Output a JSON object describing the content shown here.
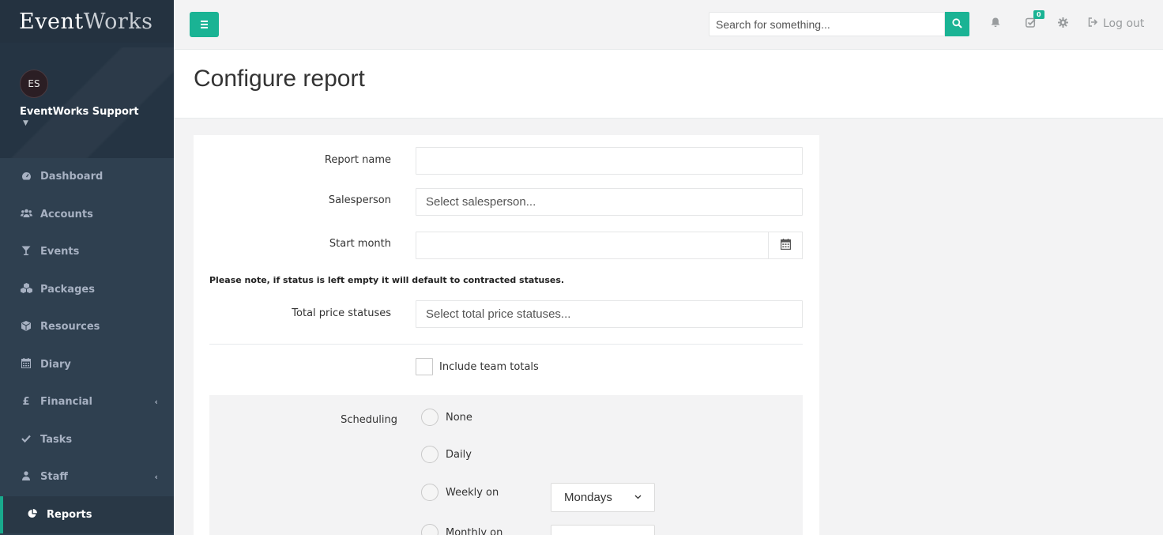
{
  "app": {
    "logo_part1": "Event",
    "logo_part2": "Works"
  },
  "profile": {
    "initials": "ES",
    "name": "EventWorks Support"
  },
  "nav": {
    "items": [
      {
        "label": "Dashboard",
        "icon": "tachometer-icon"
      },
      {
        "label": "Accounts",
        "icon": "users-icon"
      },
      {
        "label": "Events",
        "icon": "glass-icon"
      },
      {
        "label": "Packages",
        "icon": "cubes-icon"
      },
      {
        "label": "Resources",
        "icon": "cube-icon"
      },
      {
        "label": "Diary",
        "icon": "calendar-icon"
      },
      {
        "label": "Financial",
        "icon": "pound-icon"
      },
      {
        "label": "Tasks",
        "icon": "check-icon"
      },
      {
        "label": "Staff",
        "icon": "user-icon"
      },
      {
        "label": "Reports",
        "icon": "pie-chart-icon"
      }
    ],
    "active": "Reports"
  },
  "topbar": {
    "search_placeholder": "Search for something...",
    "tasks_badge": "0",
    "logout_label": "Log out"
  },
  "page": {
    "title": "Configure report"
  },
  "form": {
    "report_name_label": "Report name",
    "report_name_value": "",
    "salesperson_label": "Salesperson",
    "salesperson_placeholder": "Select salesperson...",
    "start_month_label": "Start month",
    "start_month_value": "",
    "status_note": "Please note, if status is left empty it will default to contracted statuses.",
    "total_price_statuses_label": "Total price statuses",
    "total_price_statuses_placeholder": "Select total price statuses...",
    "include_team_totals_label": "Include team totals",
    "include_team_totals_checked": false,
    "scheduling_label": "Scheduling",
    "scheduling_options": [
      "None",
      "Daily",
      "Weekly on",
      "Monthly on"
    ],
    "weekly_day_selected": "Mondays"
  },
  "colors": {
    "accent": "#1ab394",
    "sidebar_bg": "#2f4050"
  }
}
